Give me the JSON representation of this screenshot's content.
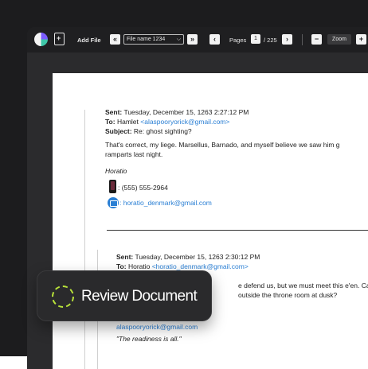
{
  "toolbar": {
    "add_file_label": "Add File",
    "file_select_value": "File name 1234",
    "pages_label": "Pages",
    "current_page": "1",
    "total_pages": "/ 225",
    "zoom_label": "Zoom",
    "zoom_minus": "−",
    "zoom_plus": "+",
    "first_arrow": "«",
    "last_arrow": "»",
    "prev_arrow": "‹",
    "next_arrow": "›",
    "caret": "⌵"
  },
  "email1": {
    "sent_label": "Sent:",
    "sent_value": " Tuesday, December 15, 1263 2:27:12 PM",
    "to_label": "To:",
    "to_name": " Hamlet ",
    "to_email": "<alaspooryorick@gmail.com>",
    "subject_label": "Subject:",
    "subject_value": " Re: ghost sighting?",
    "body_line1": "That's correct, my liege. Marsellus, Barnado, and myself believe we saw him g",
    "body_line2": "ramparts last night.",
    "signature": "Horatio",
    "phone": ": (555) 555-2964",
    "contact_email": ": horatio_denmark@gmail.com"
  },
  "email2": {
    "sent_label": "Sent:",
    "sent_value": " Tuesday, December 15, 1263 2:30:12 PM",
    "to_label": "To:",
    "to_name": " Horatio ",
    "to_email": "<horatio_denmark@gmail.com>",
    "body_line1": "e defend us, but we must meet this e'en. Can",
    "body_line2": "outside the throne room at dusk?",
    "contact_email": "alaspooryorick@gmail.com",
    "quote": "\"The readiness is all.\""
  },
  "badge": {
    "label": "Review Document"
  },
  "colors": {
    "accent_green": "#b8e23a",
    "link_blue": "#2a7fd4"
  }
}
